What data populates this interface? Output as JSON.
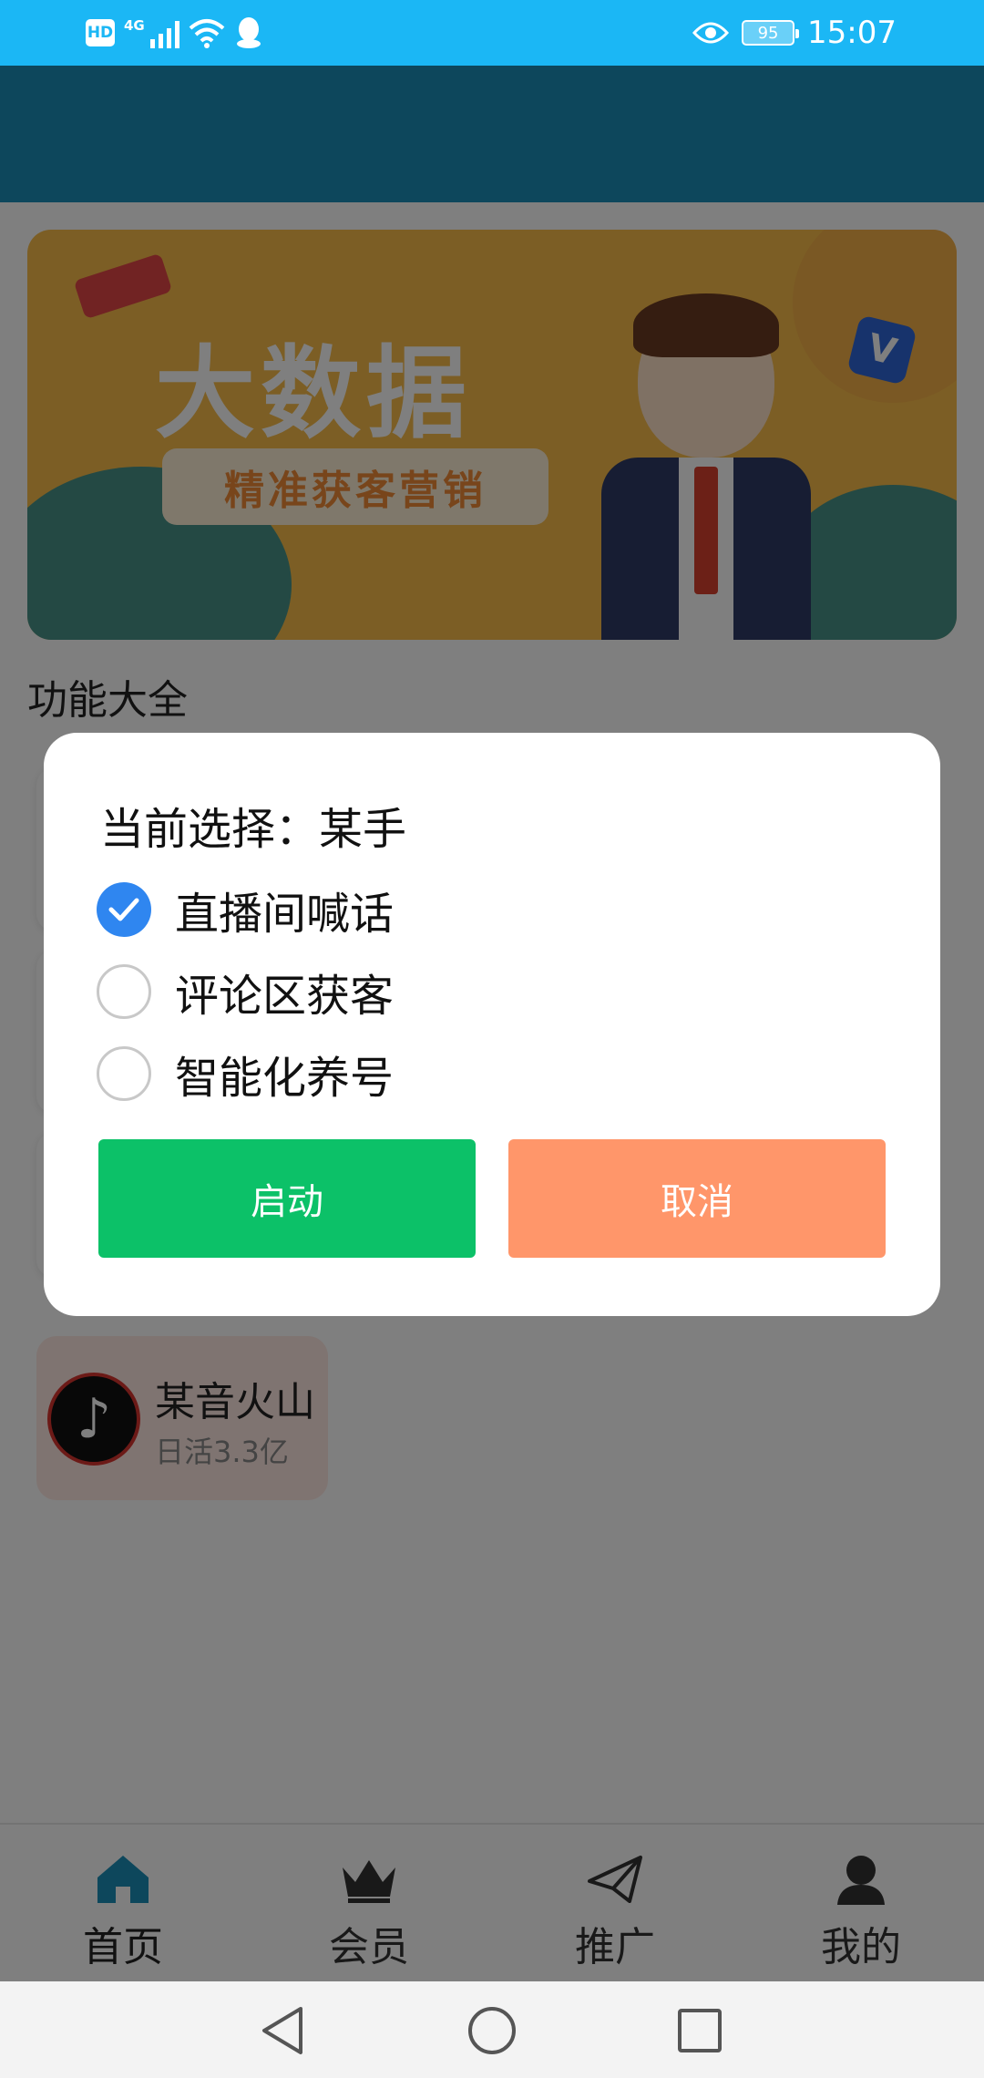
{
  "status_bar": {
    "time": "15:07",
    "battery": "95",
    "network": "4G",
    "hd": "HD",
    "icons": [
      "hd-icon",
      "signal-icon",
      "wifi-icon",
      "qq-icon",
      "eye-icon",
      "battery-icon"
    ]
  },
  "banner": {
    "title": "大数据",
    "subtitle": "精准获客营销",
    "badge": "V"
  },
  "section": {
    "title": "功能大全"
  },
  "app_card": {
    "name": "某音火山",
    "subtitle": "日活3.3亿"
  },
  "dialog": {
    "title": "当前选择：某手",
    "options": [
      {
        "label": "直播间喊话",
        "checked": true
      },
      {
        "label": "评论区获客",
        "checked": false
      },
      {
        "label": "智能化养号",
        "checked": false
      }
    ],
    "start_label": "启动",
    "cancel_label": "取消"
  },
  "bottom_nav": {
    "items": [
      {
        "label": "首页",
        "icon": "home-icon",
        "active": true
      },
      {
        "label": "会员",
        "icon": "crown-icon",
        "active": false
      },
      {
        "label": "推广",
        "icon": "paper-plane-icon",
        "active": false
      },
      {
        "label": "我的",
        "icon": "user-icon",
        "active": false
      }
    ]
  },
  "colors": {
    "status_bar": "#1bb7f5",
    "header": "#1b8fb8",
    "start_button": "#0cc168",
    "cancel_button": "#ff966a",
    "radio_checked": "#2f86f0",
    "nav_active": "#1b8fb8"
  }
}
